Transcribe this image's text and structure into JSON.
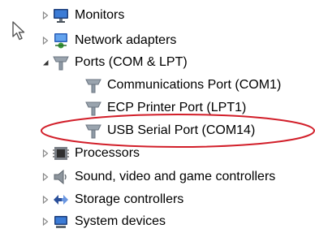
{
  "tree": {
    "items": [
      {
        "label": "Monitors",
        "expander": "collapsed",
        "icon": "monitor-icon"
      },
      {
        "label": "Network adapters",
        "expander": "collapsed",
        "icon": "network-adapter-icon"
      },
      {
        "label": "Ports (COM & LPT)",
        "expander": "expanded",
        "icon": "port-icon",
        "children": [
          {
            "label": "Communications Port (COM1)",
            "icon": "port-icon"
          },
          {
            "label": "ECP Printer Port (LPT1)",
            "icon": "port-icon"
          },
          {
            "label": "USB Serial Port (COM14)",
            "icon": "port-icon",
            "highlighted": true
          }
        ]
      },
      {
        "label": "Processors",
        "expander": "collapsed",
        "icon": "processor-icon"
      },
      {
        "label": "Sound, video and game controllers",
        "expander": "collapsed",
        "icon": "speaker-icon"
      },
      {
        "label": "Storage controllers",
        "expander": "collapsed",
        "icon": "storage-icon"
      },
      {
        "label": "System devices",
        "expander": "collapsed",
        "icon": "system-devices-icon"
      }
    ]
  },
  "colors": {
    "highlight_ellipse": "#d21f2a",
    "expander": "#8a8a8a",
    "port_icon": "#8f9aa6"
  }
}
